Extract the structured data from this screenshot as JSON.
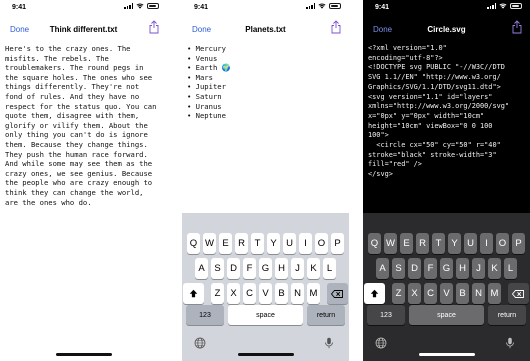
{
  "colors": {
    "accent": "#2f5bd6",
    "keyboard_light": "#d2d5db",
    "keyboard_dark": "#2b2b2d"
  },
  "phones": [
    {
      "time": "9:41",
      "done_label": "Done",
      "title": "Think different.txt",
      "content": "Here's to the crazy ones. The\nmisfits. The rebels. The\ntroublemakers. The round pegs in\nthe square holes. The ones who see\nthings differently. They're not\nfond of rules. And they have no\nrespect for the status quo. You can\nquote them, disagree with them,\nglorify or vilify them. About the\nonly thing you can't do is ignore\nthem. Because they change things.\nThey push the human race forward.\nAnd while some may see them as the\ncrazy ones, we see genius. Because\nthe people who are crazy enough to\nthink they can change the world,\nare the ones who do."
    },
    {
      "time": "9:41",
      "done_label": "Done",
      "title": "Planets.txt",
      "content": "• Mercury\n• Venus\n• Earth 🌍\n• Mars\n• Jupiter\n• Saturn\n• Uranus\n• Neptune"
    },
    {
      "time": "9:41",
      "done_label": "Done",
      "title": "Circle.svg",
      "content": "<?xml version=\"1.0\"\nencoding=\"utf-8\"?>\n<!DOCTYPE svg PUBLIC \"-//W3C//DTD\nSVG 1.1//EN\" \"http://www.w3.org/\nGraphics/SVG/1.1/DTD/svg11.dtd\">\n<svg version=\"1.1\" id=\"layers\"\nxmlns=\"http://www.w3.org/2000/svg\"\nx=\"0px\" y=\"0px\" width=\"10cm\"\nheight=\"10cm\" viewBox=\"0 0 100\n100\">\n  <circle cx=\"50\" cy=\"50\" r=\"40\"\nstroke=\"black\" stroke-width=\"3\"\nfill=\"red\" />\n</svg>"
    }
  ],
  "keyboard": {
    "row1": [
      "Q",
      "W",
      "E",
      "R",
      "T",
      "Y",
      "U",
      "I",
      "O",
      "P"
    ],
    "row2": [
      "A",
      "S",
      "D",
      "F",
      "G",
      "H",
      "J",
      "K",
      "L"
    ],
    "row3": [
      "Z",
      "X",
      "C",
      "V",
      "B",
      "N",
      "M"
    ],
    "numbers_label": "123",
    "space_label": "space",
    "return_label": "return"
  },
  "icons": {
    "share": "share-icon",
    "shift": "shift-icon",
    "delete": "backspace-icon",
    "globe": "globe-icon",
    "mic": "microphone-icon"
  }
}
